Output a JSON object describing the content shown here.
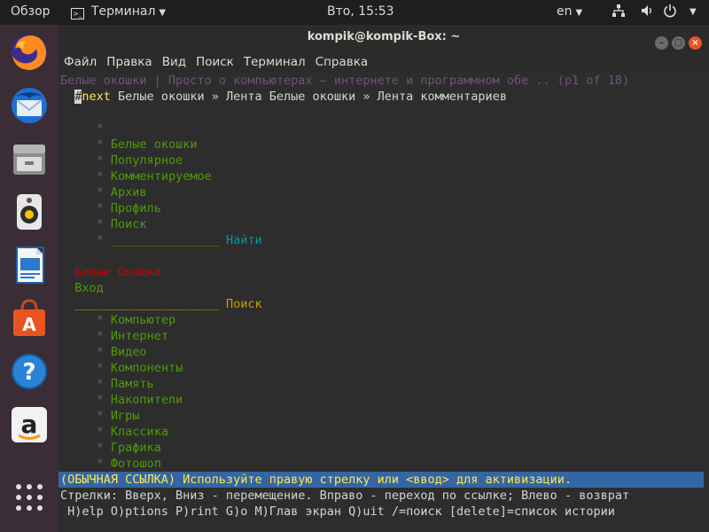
{
  "top_panel": {
    "activities": "Обзор",
    "app_menu": "Терминал",
    "clock": "Вто, 15:53",
    "keyboard_layout": "en"
  },
  "window": {
    "title": "kompik@kompik-Box: ~",
    "menu": [
      "Файл",
      "Правка",
      "Вид",
      "Поиск",
      "Терминал",
      "Справка"
    ]
  },
  "terminal": {
    "header_line": "Белые окошки | Просто о компьютерах — интернете и программном обе .. (p1 of 18)",
    "nav_hash": "#",
    "nav_next": "next",
    "nav_rest": " Белые окошки » Лента Белые окошки » Лента комментариев",
    "menu_bullet": "*",
    "menu_items": [
      "Белые окошки",
      "Популярное",
      "Комментируемое",
      "Архив",
      "Профиль",
      "Поиск"
    ],
    "search_field": "_______________",
    "search_button": "Найти",
    "site_title": "Белые Окошки",
    "login_link": "Вход",
    "search2_field": "____________________",
    "search2_button": "Поиск",
    "categories": [
      "Компьютер",
      "Интернет",
      "Видео",
      "Компоненты",
      "Память",
      "Накопители",
      "Игры",
      "Классика",
      "Графика",
      "Фотошоп"
    ],
    "status_line": "(ОБЫЧНАЯ ССЫЛКА) Используйте правую стрелку или <ввод> для активизации.",
    "help_line1": "Стрелки: Вверх, Вниз - перемещение. Вправо - переход по ссылке; Влево - возврат",
    "help_line2": " H)elp O)ptions P)rint G)o M)Глав экран Q)uit /=поиск [delete]=список истории"
  },
  "launcher": [
    "firefox-icon",
    "thunderbird-icon",
    "files-icon",
    "rhythmbox-icon",
    "libreoffice-writer-icon",
    "software-center-icon",
    "help-icon",
    "amazon-icon",
    "show-apps-icon"
  ],
  "colors": {
    "ubuntu_orange": "#e95420",
    "link_green": "#4e9a06",
    "title_red": "#cc0000",
    "status_blue": "#3465a4",
    "status_yellow": "#fce94f"
  }
}
